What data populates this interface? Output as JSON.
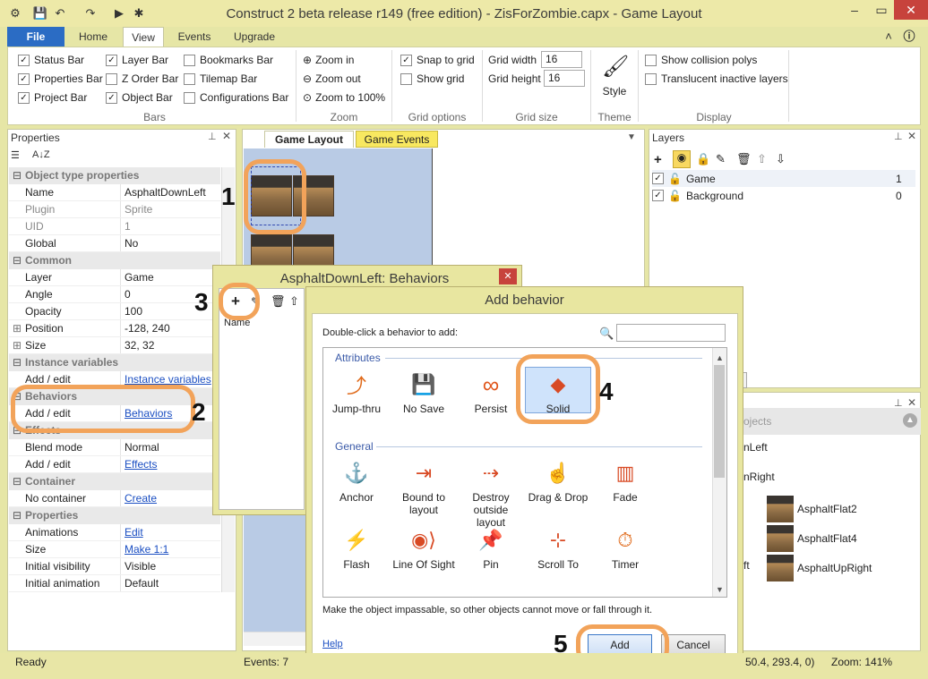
{
  "window": {
    "title": "Construct 2 beta release r149  (free edition) - ZisForZombie.capx - Game Layout"
  },
  "ribbon": {
    "tabs": [
      "File",
      "Home",
      "View",
      "Events",
      "Upgrade"
    ],
    "bars": {
      "status": "Status Bar",
      "properties": "Properties Bar",
      "project": "Project Bar",
      "layer": "Layer Bar",
      "zorder": "Z Order Bar",
      "object": "Object Bar",
      "bookmarks": "Bookmarks Bar",
      "tilemap": "Tilemap Bar",
      "configurations": "Configurations Bar",
      "group": "Bars"
    },
    "zoom": {
      "in": "Zoom in",
      "out": "Zoom out",
      "to100": "Zoom to 100%",
      "group": "Zoom"
    },
    "grid": {
      "snap": "Snap to grid",
      "show": "Show grid",
      "group": "Grid options"
    },
    "gridsize": {
      "width_label": "Grid width",
      "width": "16",
      "height_label": "Grid height",
      "height": "16",
      "group": "Grid size"
    },
    "theme": {
      "style": "Style",
      "group": "Theme"
    },
    "display": {
      "collision": "Show collision polys",
      "translucent": "Translucent inactive layers",
      "group": "Display"
    }
  },
  "properties": {
    "header": "Properties",
    "sections": [
      {
        "cat": "Object type properties"
      },
      {
        "k": "Name",
        "v": "AsphaltDownLeft"
      },
      {
        "k": "Plugin",
        "v": "Sprite",
        "dim": true
      },
      {
        "k": "UID",
        "v": "1",
        "dim": true
      },
      {
        "k": "Global",
        "v": "No"
      },
      {
        "cat": "Common"
      },
      {
        "k": "Layer",
        "v": "Game"
      },
      {
        "k": "Angle",
        "v": "0"
      },
      {
        "k": "Opacity",
        "v": "100"
      },
      {
        "k": "Position",
        "v": "-128, 240",
        "exp": true
      },
      {
        "k": "Size",
        "v": "32, 32",
        "exp": true
      },
      {
        "cat": "Instance variables"
      },
      {
        "k": "Add / edit",
        "v": "Instance variables",
        "link": true
      },
      {
        "cat": "Behaviors"
      },
      {
        "k": "Add / edit",
        "v": "Behaviors",
        "link": true
      },
      {
        "cat": "Effects"
      },
      {
        "k": "Blend mode",
        "v": "Normal"
      },
      {
        "k": "Add / edit",
        "v": "Effects",
        "link": true
      },
      {
        "cat": "Container"
      },
      {
        "k": "No container",
        "v": "Create",
        "link": true
      },
      {
        "cat": "Properties"
      },
      {
        "k": "Animations",
        "v": "Edit",
        "link": true
      },
      {
        "k": "Size",
        "v": "Make 1:1",
        "link": true
      },
      {
        "k": "Initial visibility",
        "v": "Visible"
      },
      {
        "k": "Initial animation",
        "v": "Default"
      }
    ]
  },
  "doc_tabs": {
    "layout": "Game Layout",
    "events": "Game Events"
  },
  "layers": {
    "header": "Layers",
    "items": [
      {
        "name": "Game",
        "idx": "1"
      },
      {
        "name": "Background",
        "idx": "0"
      }
    ]
  },
  "objects": {
    "partial_header": "ojects",
    "partial1": "nLeft",
    "partial2": "nRight",
    "partial3": "ft",
    "items": [
      "AsphaltFlat2",
      "AsphaltFlat4",
      "AsphaltUpRight"
    ]
  },
  "behaviors_dialog": {
    "title": "AsphaltDownLeft: Behaviors",
    "col": "Name"
  },
  "add_behavior": {
    "title": "Add behavior",
    "prompt": "Double-click a behavior to add:",
    "attributes_label": "Attributes",
    "general_label": "General",
    "attributes": [
      "Jump-thru",
      "No Save",
      "Persist",
      "Solid"
    ],
    "general": [
      "Anchor",
      "Bound to layout",
      "Destroy outside layout",
      "Drag & Drop",
      "Fade",
      "Flash",
      "Line Of Sight",
      "Pin",
      "Scroll To",
      "Timer"
    ],
    "description": "Make the object impassable, so other objects cannot move or fall through it.",
    "help": "Help",
    "add": "Add",
    "cancel": "Cancel"
  },
  "annotations": [
    "1",
    "2",
    "3",
    "4",
    "5"
  ],
  "status": {
    "ready": "Ready",
    "events": "Events: 7",
    "coords": "50.4, 293.4, 0)",
    "zoom": "Zoom: 141%"
  }
}
